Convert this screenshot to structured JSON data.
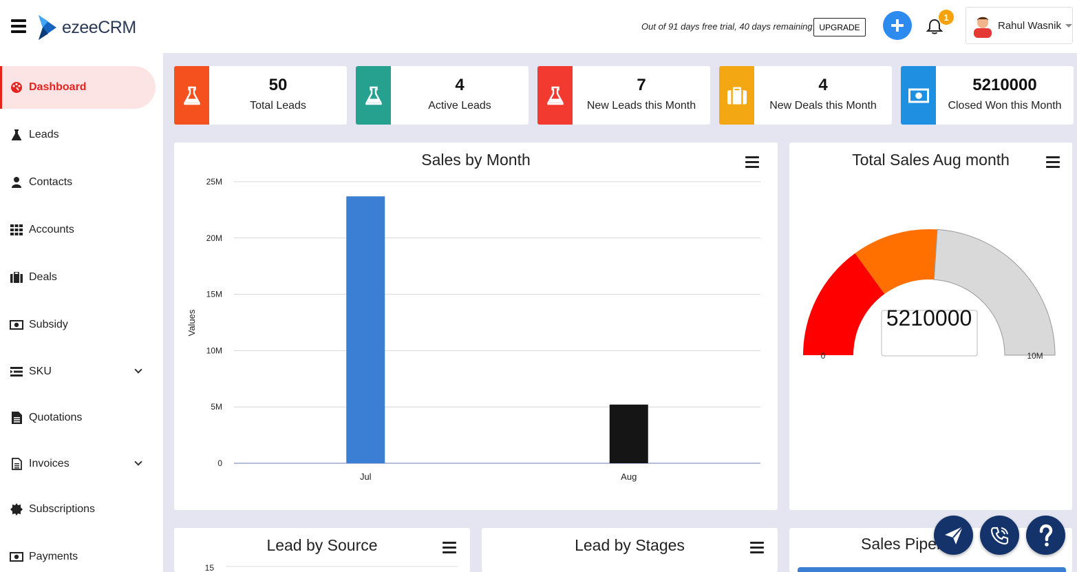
{
  "header": {
    "logo_text": "ezeeCRM",
    "trial_text": "Out of 91 days free trial, 40 days remaining",
    "upgrade_label": "UPGRADE",
    "notification_count": "1",
    "user_name": "Rahul Wasnik"
  },
  "sidebar": {
    "items": [
      {
        "label": "Dashboard",
        "icon": "palette-icon"
      },
      {
        "label": "Leads",
        "icon": "flask-icon"
      },
      {
        "label": "Contacts",
        "icon": "user-icon"
      },
      {
        "label": "Accounts",
        "icon": "grid-icon"
      },
      {
        "label": "Deals",
        "icon": "briefcase-icon"
      },
      {
        "label": "Subsidy",
        "icon": "money-icon"
      },
      {
        "label": "SKU",
        "icon": "list-icon"
      },
      {
        "label": "Quotations",
        "icon": "document-icon"
      },
      {
        "label": "Invoices",
        "icon": "invoice-icon"
      },
      {
        "label": "Subscriptions",
        "icon": "badge-icon"
      },
      {
        "label": "Payments",
        "icon": "money-icon"
      }
    ]
  },
  "stats": [
    {
      "value": "50",
      "label": "Total Leads",
      "color": "#f4511e",
      "icon": "flask-icon"
    },
    {
      "value": "4",
      "label": "Active Leads",
      "color": "#26a08f",
      "icon": "flask-icon"
    },
    {
      "value": "7",
      "label": "New Leads this Month",
      "color": "#f23a30",
      "icon": "flask-icon"
    },
    {
      "value": "4",
      "label": "New Deals this Month",
      "color": "#f3a712",
      "icon": "briefcase-icon"
    },
    {
      "value": "5210000",
      "label": "Closed Won this Month",
      "color": "#1e8fe1",
      "icon": "money-icon"
    }
  ],
  "panels": {
    "sales_by_month": "Sales by Month",
    "total_sales": "Total Sales Aug month",
    "lead_by_source": "Lead by Source",
    "lead_by_stages": "Lead by Stages",
    "sales_pipeline": "Sales Pipeline"
  },
  "chart_data": [
    {
      "type": "bar",
      "title": "Sales by Month",
      "ylabel": "Values",
      "categories": [
        "Jul",
        "Aug"
      ],
      "values": [
        23700000,
        5210000
      ],
      "colors": [
        "#3b7fd4",
        "#151515"
      ],
      "yticks": [
        "0",
        "5M",
        "10M",
        "15M",
        "20M",
        "25M"
      ],
      "ylim": [
        0,
        25000000
      ],
      "grid": true
    },
    {
      "type": "gauge",
      "title": "Total Sales Aug month",
      "value": 5210000,
      "value_label": "5210000",
      "min_label": "0",
      "max_label": "10M",
      "range": [
        0,
        10000000
      ],
      "bands": [
        {
          "to": 3000000,
          "color": "#ff0000"
        },
        {
          "to": 5210000,
          "color": "#ff7000"
        },
        {
          "to": 10000000,
          "color": "#d9d9d9"
        }
      ]
    },
    {
      "type": "bar",
      "title": "Lead by Source",
      "yticks": [
        "15"
      ]
    }
  ]
}
